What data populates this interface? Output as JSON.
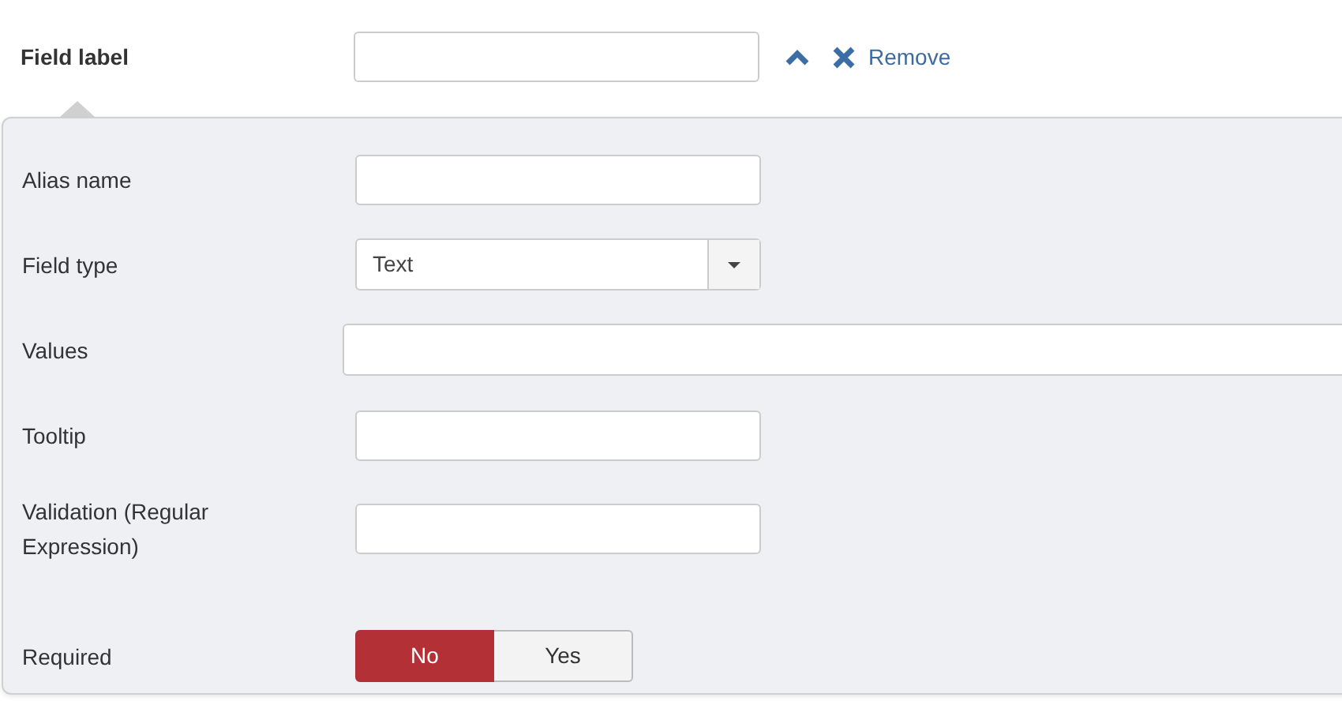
{
  "header": {
    "label": "Field label",
    "actions": {
      "remove": "Remove"
    }
  },
  "fields": [
    {
      "kind": "text",
      "label": "Alias name"
    },
    {
      "kind": "select",
      "label": "Field type",
      "value": "Text"
    },
    {
      "kind": "wide",
      "label": "Values"
    },
    {
      "kind": "text",
      "label": "Tooltip"
    },
    {
      "kind": "text",
      "label": "Validation (Regular Expression)"
    },
    {
      "kind": "toggle",
      "label": "Required",
      "options": [
        {
          "label": "No",
          "selected": true
        },
        {
          "label": "Yes",
          "selected": false
        }
      ]
    }
  ]
}
